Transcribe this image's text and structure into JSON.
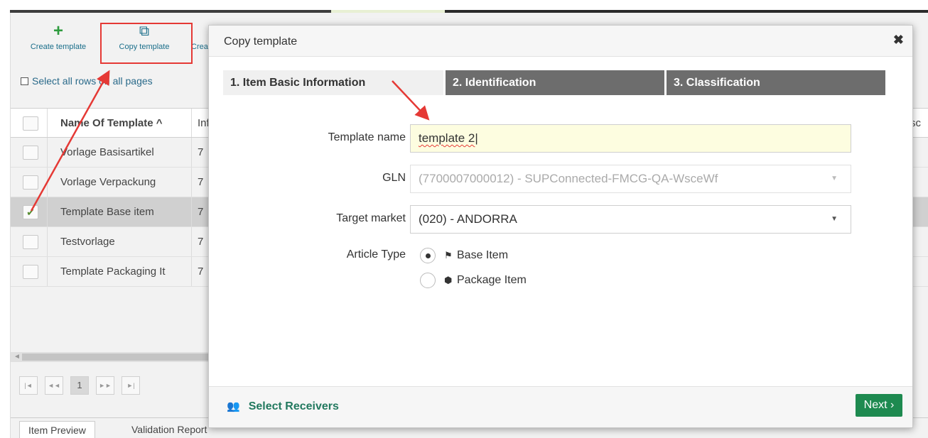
{
  "toolbar": {
    "create_label": "Create template",
    "copy_label": "Copy template",
    "create2_label": "Create"
  },
  "select_all": "Select all rows on all pages",
  "grid": {
    "header": {
      "name": "Name Of Template ^",
      "info": "Inf",
      "right": "sc"
    },
    "rows": [
      {
        "name": "Vorlage Basisartikel",
        "info": "7",
        "checked": false
      },
      {
        "name": "Vorlage Verpackung",
        "info": "7",
        "checked": false
      },
      {
        "name": "Template Base item",
        "info": "7",
        "checked": true
      },
      {
        "name": "Testvorlage",
        "info": "7",
        "checked": false
      },
      {
        "name": "Template Packaging It",
        "info": "7",
        "checked": false
      }
    ]
  },
  "pager": {
    "first": "|◄",
    "prev": "◄◄",
    "page": "1",
    "next": "►►",
    "last": "►|"
  },
  "bottom_tabs": [
    "Item Preview",
    "Validation Report"
  ],
  "modal": {
    "title": "Copy template",
    "close": "✖",
    "steps": [
      "1. Item Basic Information",
      "2. Identification",
      "3. Classification"
    ],
    "fields": {
      "template_name_label": "Template name",
      "template_name_value": "template 2",
      "gln_label": "GLN",
      "gln_value": "(7700007000012) - SUPConnected-FMCG-QA-WsceWf",
      "target_market_label": "Target market",
      "target_market_value": "(020) - ANDORRA",
      "article_type_label": "Article Type",
      "article_options": [
        "Base Item",
        "Package Item"
      ],
      "article_selected": "Base Item"
    },
    "footer": {
      "receivers": "Select Receivers",
      "next": "Next ›"
    }
  },
  "colors": {
    "accent_green": "#1e8a50",
    "receivers_green": "#22795f",
    "highlight_red": "#e53935",
    "step_inactive": "#6d6d6d"
  }
}
